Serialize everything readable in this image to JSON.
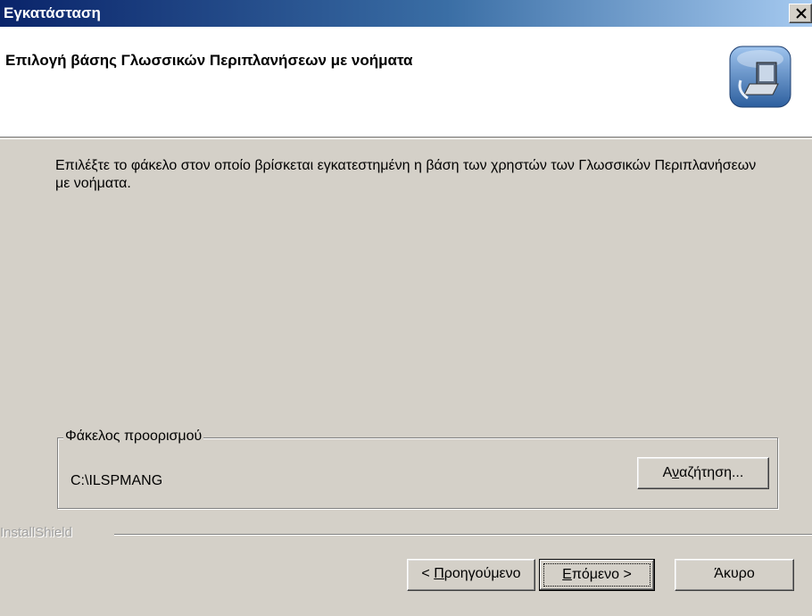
{
  "window": {
    "title": "Εγκατάσταση"
  },
  "header": {
    "title": "Επιλογή βάσης Γλωσσικών Περιπλανήσεων με νοήματα"
  },
  "description": "Επιλέξτε το φάκελο στον οποίο βρίσκεται εγκατεστημένη η βάση των χρηστών των Γλωσσικών Περιπλανήσεων με νοήματα.",
  "destination": {
    "group_label": "Φάκελος προορισμού",
    "path": "C:\\ILSPMANG",
    "browse_pre": "Α",
    "browse_ul": "ν",
    "browse_post": "αζήτηση..."
  },
  "footer": {
    "brand": "InstallShield",
    "back_pre": "< ",
    "back_ul": "Π",
    "back_post": "ροηγούμενο",
    "next_ul": "Ε",
    "next_post": "πόμενο >",
    "cancel": "Άκυρο"
  },
  "icons": {
    "close": "close-icon",
    "setup": "computer-setup-icon"
  }
}
